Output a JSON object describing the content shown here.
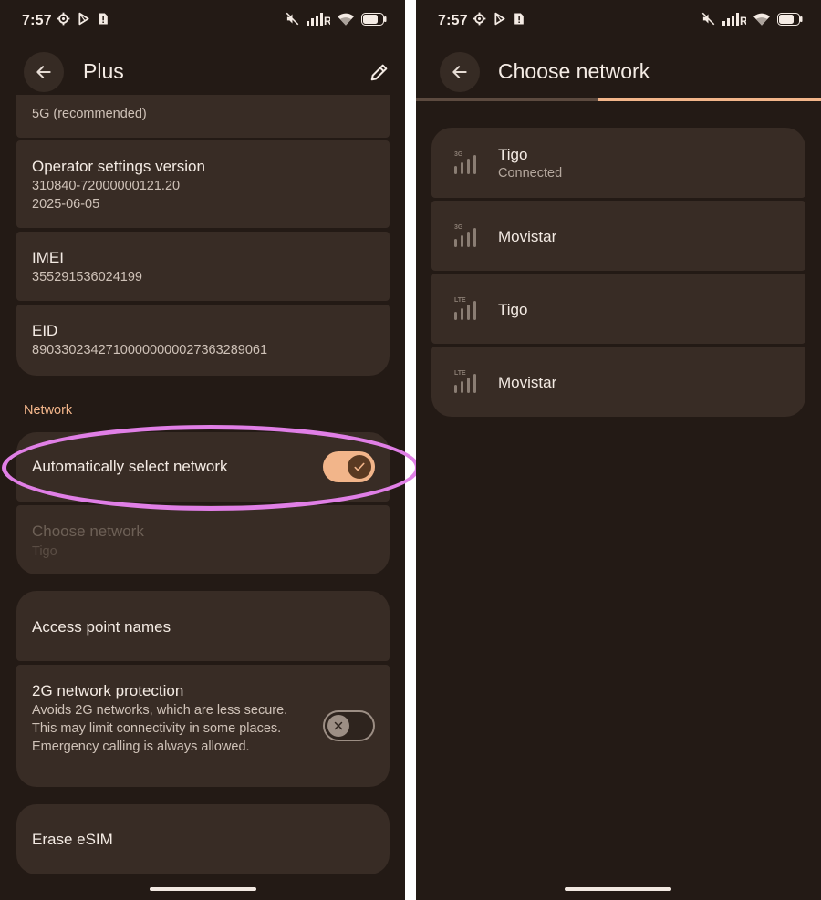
{
  "status_bar": {
    "time": "7:57",
    "roaming_indicator": "R"
  },
  "left_screen": {
    "title": "Plus",
    "preferred_network_value": "5G (recommended)",
    "operator_settings": {
      "title": "Operator settings version",
      "line1": "310840-72000000121.20",
      "line2": "2025-06-05"
    },
    "imei": {
      "title": "IMEI",
      "value": "355291536024199"
    },
    "eid": {
      "title": "EID",
      "value": "89033023427100000000027363289061"
    },
    "network_section_label": "Network",
    "auto_select": {
      "title": "Automatically select network",
      "enabled": true
    },
    "choose_network": {
      "title": "Choose network",
      "value": "Tigo",
      "disabled": true
    },
    "access_point_names": {
      "title": "Access point names"
    },
    "protection_2g": {
      "title": "2G network protection",
      "description": "Avoids 2G networks, which are less secure. This may limit connectivity in some places. Emergency calling is always allowed.",
      "enabled": false
    },
    "erase_esim": {
      "title": "Erase eSIM"
    }
  },
  "right_screen": {
    "title": "Choose network",
    "scan_progress": 0.45,
    "networks": [
      {
        "name": "Tigo",
        "status": "Connected",
        "tech": "3G",
        "icon": "signal-3g-icon"
      },
      {
        "name": "Movistar",
        "status": "",
        "tech": "3G",
        "icon": "signal-3g-icon"
      },
      {
        "name": "Tigo",
        "status": "",
        "tech": "LTE",
        "icon": "signal-lte-icon"
      },
      {
        "name": "Movistar",
        "status": "",
        "tech": "LTE",
        "icon": "signal-lte-icon"
      }
    ]
  },
  "colors": {
    "background": "#231a15",
    "card": "#382c25",
    "accent": "#f2b58a",
    "text_primary": "#f4ebe4",
    "text_secondary": "#cfc2b8",
    "highlight_ring": "#e07fe6"
  }
}
